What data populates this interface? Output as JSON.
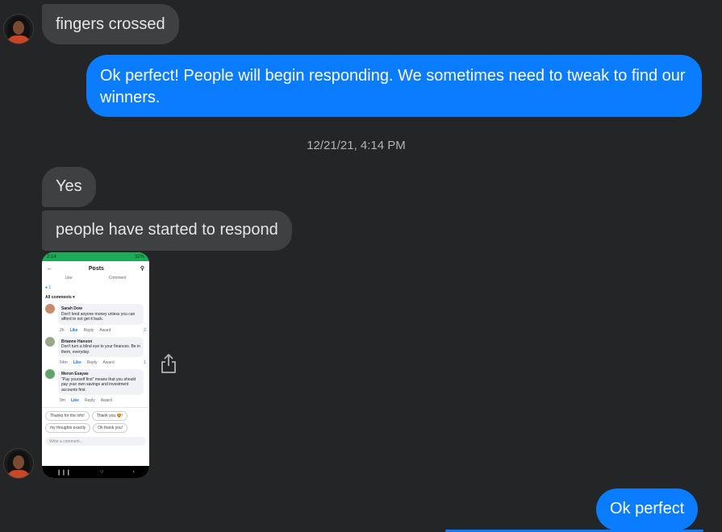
{
  "messages": {
    "m1": "fingers crossed",
    "m2": "Ok perfect! People will begin responding. We sometimes need to tweak to find our winners.",
    "timestamp": "12/21/21, 4:14 PM",
    "m3": "Yes",
    "m4": "people have started to respond",
    "m5": "Ok perfect"
  },
  "attachment": {
    "status_time": "2:14",
    "status_right": "32%",
    "title": "Posts",
    "like_label": "Like",
    "comment_label": "Comment",
    "reaction_count": "1",
    "filter_label": "All comments",
    "comments": [
      {
        "name": "Sarah Dow",
        "text": "Don't lend anyone money unless you can afford to not get it back.",
        "time": "2h",
        "like": "Like",
        "reply": "Reply",
        "award": "Award",
        "reactions": "2"
      },
      {
        "name": "Brianne Hanson",
        "text": "Don't turn a blind eye to your finances. Be in them, everyday.",
        "time": "54m",
        "like": "Like",
        "reply": "Reply",
        "award": "Award",
        "reactions": "1"
      },
      {
        "name": "Meron Esayas",
        "text": "\"Pay yourself first\" means that you should pay your own savings and investment accounts first.",
        "time": "9m",
        "like": "Like",
        "reply": "Reply",
        "award": "Award",
        "reactions": ""
      }
    ],
    "chips": [
      "Thanks for the info!",
      "Thank you 😍!",
      "my thoughts exactly",
      "Ok thank you!"
    ],
    "composer_placeholder": "Write a comment..."
  },
  "colors": {
    "background": "#242526",
    "incoming": "#3e4042",
    "outgoing": "#0a7cff"
  },
  "icons": {
    "share": "share-icon"
  }
}
